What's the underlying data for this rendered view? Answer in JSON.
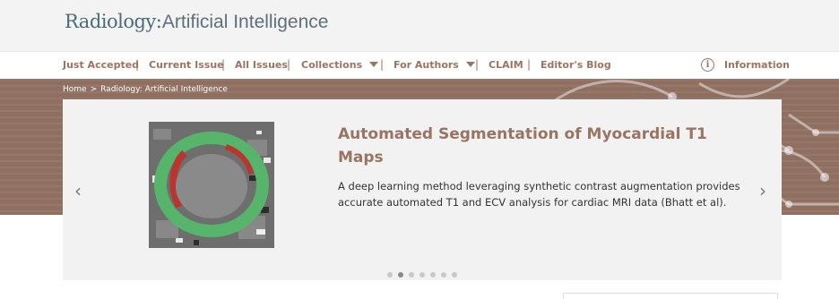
{
  "header": {
    "journal": "Radiology",
    "separator": ":",
    "subtitle": "Artificial Intelligence"
  },
  "nav": {
    "items": [
      {
        "label": "Just Accepted"
      },
      {
        "label": "Current Issue"
      },
      {
        "label": "All Issues"
      },
      {
        "label": "Collections"
      },
      {
        "label": "For Authors"
      },
      {
        "label": "CLAIM"
      },
      {
        "label": "Editor's Blog"
      }
    ],
    "divider": "|",
    "information": "Information",
    "info_icon": "i"
  },
  "breadcrumb": {
    "home": "Home",
    "separator": ">",
    "current": "Radiology: Artificial Intelligence"
  },
  "carousel": {
    "title": "Automated Segmentation of Myocardial T1 Maps",
    "description": "A deep learning method leveraging synthetic contrast augmentation provides accurate automated T1 and ECV analysis for cardiac MRI data (Bhatt et al).",
    "prev_arrow": "‹",
    "next_arrow": "›",
    "slide_count": 7,
    "active_slide": 2
  },
  "colors": {
    "accent": "#9a7461",
    "banner": "#8f6f60",
    "logo": "#4a6b7a"
  }
}
